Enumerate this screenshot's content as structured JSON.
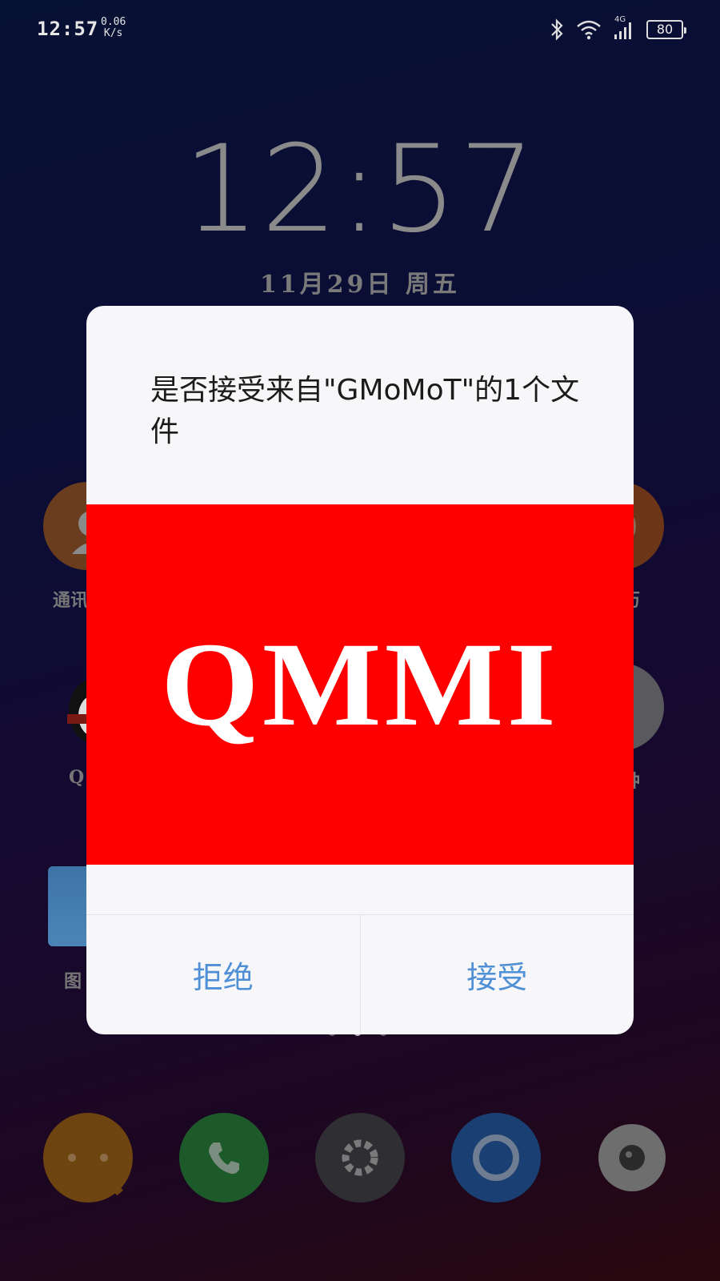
{
  "status_bar": {
    "time": "12:57",
    "net_speed_value": "0.06",
    "net_speed_unit": "K/s",
    "network_type": "4G",
    "battery": "80"
  },
  "lockscreen": {
    "time": "12:57",
    "date": "11月29日 周五"
  },
  "background_apps": {
    "left_labels": [
      "通讯",
      "Q",
      "图"
    ],
    "right_labels": [
      "历",
      "钟"
    ]
  },
  "dialog": {
    "message": "是否接受来自\"GMoMoT\"的1个文件",
    "preview_text": "QMMI",
    "reject_label": "拒绝",
    "accept_label": "接受"
  },
  "dock": {
    "icons": [
      "messages-icon",
      "phone-icon",
      "settings-icon",
      "browser-icon",
      "camera-icon"
    ]
  }
}
